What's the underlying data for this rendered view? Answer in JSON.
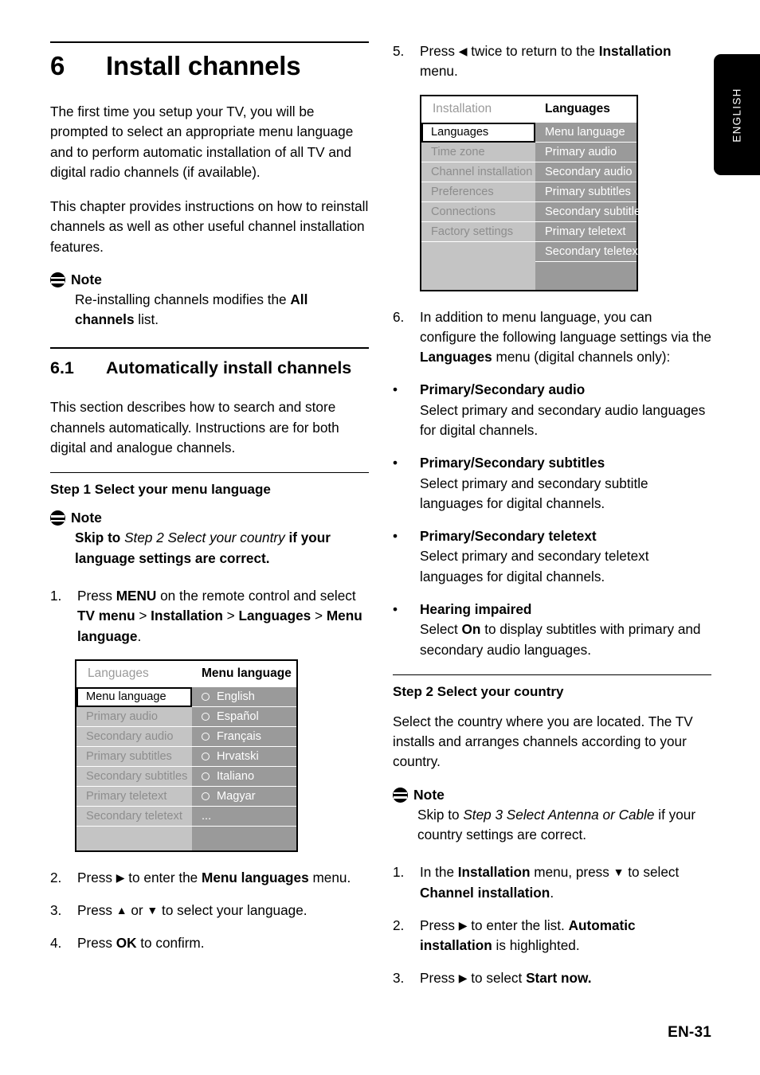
{
  "page": {
    "footer_label": "EN-31",
    "side_tab_label": "ENGLISH"
  },
  "chapter": {
    "number": "6",
    "title": "Install channels",
    "intro_1": "The first time you setup your TV, you will be prompted to select an appropriate menu language and to perform automatic installation of all TV and digital radio channels (if available).",
    "intro_2": "This chapter provides instructions on how to reinstall channels as well as other useful channel installation features."
  },
  "note_chapter": {
    "title": "Note",
    "text_a": "Re-installing channels modifies the ",
    "text_b": "All channels",
    "text_c": " list."
  },
  "section": {
    "number": "6.1",
    "title": "Automatically install channels",
    "intro": "This section describes how to search and store channels automatically. Instructions are for both digital and analogue channels."
  },
  "step1": {
    "heading": "Step 1 Select your menu language",
    "note": {
      "title": "Note",
      "text_a": "Skip to ",
      "text_b": "Step 2 Select your country",
      "text_c": " if your language settings are correct."
    },
    "items": [
      {
        "num": "1.",
        "parts": [
          {
            "t": "Press ",
            "s": "plain"
          },
          {
            "t": "MENU",
            "s": "bold"
          },
          {
            "t": " on the remote control and select ",
            "s": "plain"
          },
          {
            "t": "TV menu",
            "s": "bold"
          },
          {
            "t": " > ",
            "s": "plain"
          },
          {
            "t": "Installation",
            "s": "bold"
          },
          {
            "t": " > ",
            "s": "plain"
          },
          {
            "t": "Languages",
            "s": "bold"
          },
          {
            "t": " > ",
            "s": "plain"
          },
          {
            "t": "Menu language",
            "s": "bold"
          },
          {
            "t": ".",
            "s": "plain"
          }
        ]
      },
      {
        "num": "2.",
        "parts": [
          {
            "t": "Press ",
            "s": "plain"
          },
          {
            "t": "▶",
            "s": "arrow"
          },
          {
            "t": " to enter the ",
            "s": "plain"
          },
          {
            "t": "Menu languages",
            "s": "bold"
          },
          {
            "t": " menu.",
            "s": "plain"
          }
        ]
      },
      {
        "num": "3.",
        "parts": [
          {
            "t": "Press ",
            "s": "plain"
          },
          {
            "t": "▲",
            "s": "arrow"
          },
          {
            "t": " or ",
            "s": "plain"
          },
          {
            "t": "▼",
            "s": "arrow"
          },
          {
            "t": " to select your language.",
            "s": "plain"
          }
        ]
      },
      {
        "num": "4.",
        "parts": [
          {
            "t": "Press ",
            "s": "plain"
          },
          {
            "t": "OK",
            "s": "bold"
          },
          {
            "t": " to confirm.",
            "s": "plain"
          }
        ]
      }
    ]
  },
  "osd_menu_language": {
    "header_left": "Languages",
    "header_right": "Menu language",
    "left_items": [
      {
        "label": "Menu language",
        "selected": true
      },
      {
        "label": "Primary audio",
        "selected": false
      },
      {
        "label": "Secondary audio",
        "selected": false
      },
      {
        "label": "Primary subtitles",
        "selected": false
      },
      {
        "label": "Secondary subtitles",
        "selected": false
      },
      {
        "label": "Primary teletext",
        "selected": false
      },
      {
        "label": "Secondary teletext",
        "selected": false
      },
      {
        "label": "",
        "selected": false
      }
    ],
    "right_items": [
      {
        "label": "English",
        "radio": true
      },
      {
        "label": "Español",
        "radio": true
      },
      {
        "label": "Français",
        "radio": true
      },
      {
        "label": "Hrvatski",
        "radio": true
      },
      {
        "label": "Italiano",
        "radio": true
      },
      {
        "label": "Magyar",
        "radio": true
      },
      {
        "label": "...",
        "radio": false
      },
      {
        "label": "",
        "radio": false
      }
    ]
  },
  "step_back": {
    "items": [
      {
        "num": "5.",
        "parts": [
          {
            "t": "Press ",
            "s": "plain"
          },
          {
            "t": "◀",
            "s": "arrow"
          },
          {
            "t": " twice to return to the ",
            "s": "plain"
          },
          {
            "t": "Installation",
            "s": "bold"
          },
          {
            "t": " menu.",
            "s": "plain"
          }
        ]
      },
      {
        "num": "6.",
        "parts": [
          {
            "t": "In addition to menu language, you can configure the following language settings via the ",
            "s": "plain"
          },
          {
            "t": "Languages",
            "s": "bold"
          },
          {
            "t": " menu (digital channels only):",
            "s": "plain"
          }
        ]
      }
    ]
  },
  "osd_installation": {
    "header_left": "Installation",
    "header_right": "Languages",
    "left_items": [
      {
        "label": "Languages",
        "selected": true
      },
      {
        "label": "Time zone",
        "selected": false
      },
      {
        "label": "Channel installation",
        "selected": false
      },
      {
        "label": "Preferences",
        "selected": false
      },
      {
        "label": "Connections",
        "selected": false
      },
      {
        "label": "Factory settings",
        "selected": false
      },
      {
        "label": "",
        "selected": false
      },
      {
        "label": "",
        "selected": false
      }
    ],
    "right_items": [
      {
        "label": "Menu language",
        "highlighted": true
      },
      {
        "label": "Primary audio",
        "highlighted": false
      },
      {
        "label": "Secondary audio",
        "highlighted": false
      },
      {
        "label": "Primary subtitles",
        "highlighted": false
      },
      {
        "label": "Secondary subtitles",
        "highlighted": false
      },
      {
        "label": "Primary teletext",
        "highlighted": false
      },
      {
        "label": "Secondary teletext",
        "highlighted": false
      },
      {
        "label": "",
        "highlighted": false
      }
    ]
  },
  "language_settings": [
    {
      "bullet": "•",
      "title": "Primary/Secondary audio",
      "desc": "Select primary and secondary audio languages for digital channels."
    },
    {
      "bullet": "•",
      "title": "Primary/Secondary subtitles",
      "desc": "Select primary and secondary subtitle languages for digital channels."
    },
    {
      "bullet": "•",
      "title": "Primary/Secondary teletext",
      "desc": "Select primary and secondary teletext languages for digital channels."
    },
    {
      "bullet": "•",
      "title": "Hearing impaired",
      "desc_a": "Select ",
      "desc_b": "On",
      "desc_c": " to display subtitles with primary and secondary audio languages."
    }
  ],
  "step2": {
    "heading": "Step 2 Select your country",
    "intro": "Select the country where you are located. The TV installs and arranges channels according to your country.",
    "note": {
      "title": "Note",
      "text_a": "Skip to ",
      "text_b": "Step 3 Select Antenna or Cable",
      "text_c": " if your country settings are correct."
    },
    "items": [
      {
        "num": "1.",
        "parts": [
          {
            "t": "In the ",
            "s": "plain"
          },
          {
            "t": "Installation",
            "s": "bold"
          },
          {
            "t": " menu, press ",
            "s": "plain"
          },
          {
            "t": "▼",
            "s": "arrow"
          },
          {
            "t": " to select ",
            "s": "plain"
          },
          {
            "t": "Channel installation",
            "s": "bold"
          },
          {
            "t": ".",
            "s": "plain"
          }
        ]
      },
      {
        "num": "2.",
        "parts": [
          {
            "t": "Press ",
            "s": "plain"
          },
          {
            "t": "▶",
            "s": "arrow"
          },
          {
            "t": " to enter the list. ",
            "s": "plain"
          },
          {
            "t": "Automatic installation",
            "s": "bold"
          },
          {
            "t": " is highlighted.",
            "s": "plain"
          }
        ]
      },
      {
        "num": "3.",
        "parts": [
          {
            "t": "Press ",
            "s": "plain"
          },
          {
            "t": "▶",
            "s": "arrow"
          },
          {
            "t": " to select ",
            "s": "plain"
          },
          {
            "t": "Start now.",
            "s": "bold"
          }
        ]
      }
    ]
  },
  "colors": {
    "osd_col_left_bg": "#c4c4c4",
    "osd_col_right_bg": "#9a9a9a",
    "osd_left_text": "#8d8d8d",
    "osd_right_text": "#ffffff",
    "side_tab_bg": "#000000"
  }
}
